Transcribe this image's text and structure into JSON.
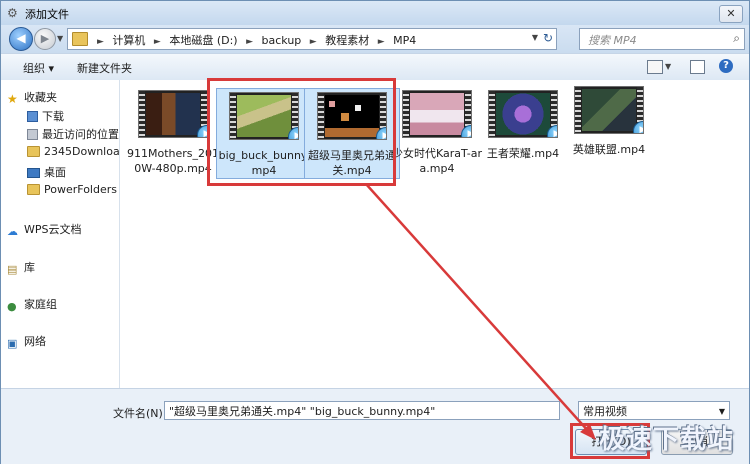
{
  "window": {
    "title": "添加文件",
    "close_glyph": "✕"
  },
  "address": {
    "crumbs": [
      "计算机",
      "本地磁盘 (D:)",
      "backup",
      "教程素材",
      "MP4"
    ],
    "search_placeholder": "搜索 MP4"
  },
  "toolbar": {
    "organize": "组织 ▾",
    "new_folder": "新建文件夹",
    "help": "?"
  },
  "nav": {
    "favorites": "收藏夹",
    "downloads": "下载",
    "recent": "最近访问的位置",
    "folder_2345": "2345Downloa",
    "desktop": "桌面",
    "powerfolders": "PowerFolders",
    "wps": "WPS云文档",
    "library": "库",
    "homegroup": "家庭组",
    "network": "网络"
  },
  "files": [
    {
      "name": "911Mothers_2010W-480p.mp4",
      "selected": false
    },
    {
      "name": "big_buck_bunny.mp4",
      "selected": true
    },
    {
      "name": "超级马里奥兄弟通关.mp4",
      "selected": true
    },
    {
      "name": "少女时代KaraT-ara.mp4",
      "selected": false
    },
    {
      "name": "王者荣耀.mp4",
      "selected": false
    },
    {
      "name": "英雄联盟.mp4",
      "selected": false
    }
  ],
  "bottom": {
    "filename_label": "文件名(N):",
    "filename_value": "\"超级马里奥兄弟通关.mp4\" \"big_buck_bunny.mp4\"",
    "filetype_value": "常用视频",
    "open_label": "打开(O)",
    "cancel_label": "取消"
  },
  "watermark": "极速下载站",
  "colors": {
    "annotation_red": "#d83a3a",
    "selection_blue": "#cde6fb"
  }
}
